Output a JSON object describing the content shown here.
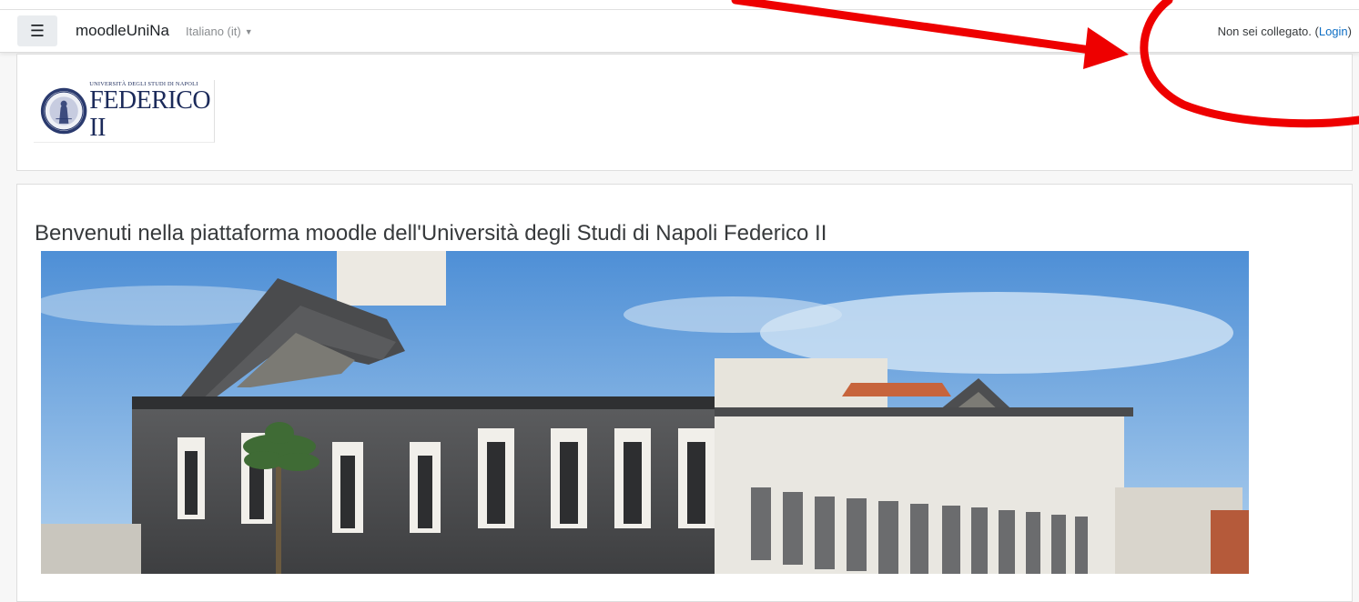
{
  "navbar": {
    "menu_icon": "hamburger-icon",
    "brand": "moodleUniNa",
    "language": "Italiano (it)",
    "caret": "▼",
    "login_prefix": "Non sei collegato. (",
    "login_link": "Login",
    "login_suffix": ")"
  },
  "header": {
    "logo_small": "UNIVERSITÀ DEGLI STUDI DI NAPOLI",
    "logo_big": "FEDERICO II"
  },
  "main": {
    "welcome_title": "Benvenuti nella piattaforma moodle dell'Università degli Studi di Napoli Federico II"
  },
  "colors": {
    "link": "#0f6fc5",
    "annotation": "#ff0000"
  }
}
